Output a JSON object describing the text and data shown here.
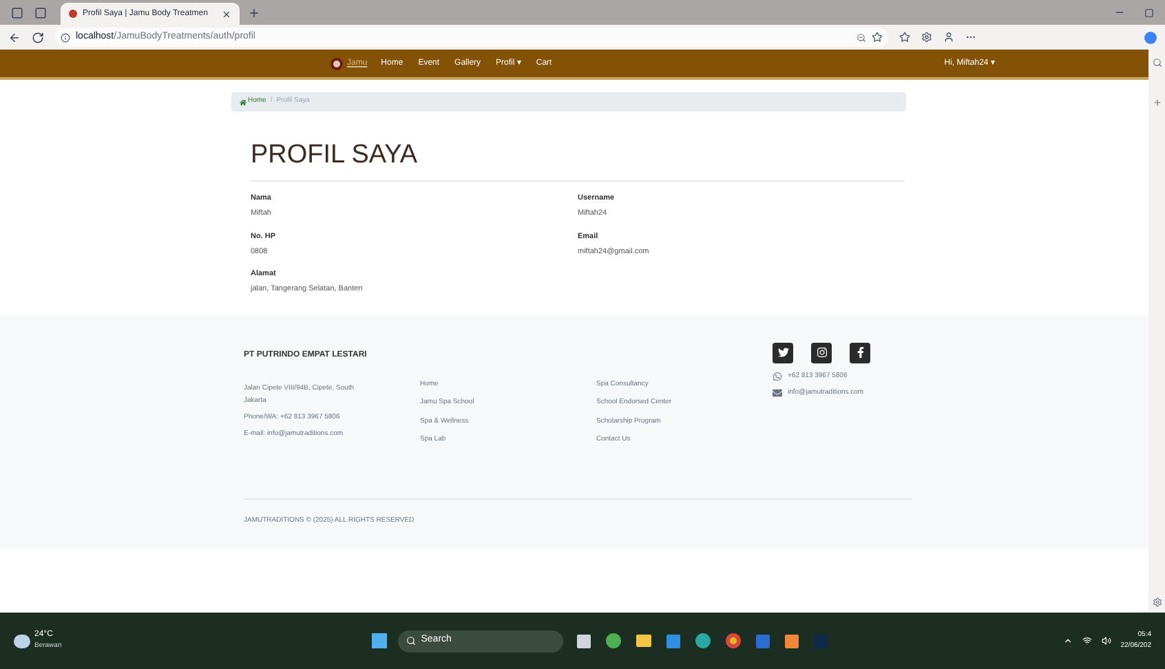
{
  "browser": {
    "tab_title": "Profil Saya | Jamu Body Treatmen",
    "url_host": "localhost",
    "url_path": "/JamuBodyTreatments/auth/profil"
  },
  "navbar": {
    "brand": "Jamu",
    "links": [
      {
        "label": "Home"
      },
      {
        "label": "Event"
      },
      {
        "label": "Gallery"
      },
      {
        "label": "Profil ▾"
      },
      {
        "label": "Cart"
      }
    ],
    "user": "Hi, Miftah24 ▾"
  },
  "breadcrumb": [
    {
      "label": "Home",
      "kind": "link"
    },
    {
      "label": "/",
      "kind": "separator"
    },
    {
      "label": "Profil Saya",
      "kind": "current"
    }
  ],
  "title": "PROFIL SAYA",
  "fields": [
    {
      "label": "Nama",
      "value": "Miftah"
    },
    {
      "label": "Username",
      "value": "Miftah24"
    },
    {
      "label": "No. HP",
      "value": "0808"
    },
    {
      "label": "Email",
      "value": "miftah24@gmail.com"
    },
    {
      "label": "Alamat",
      "value": "jalan, Tangerang Selatan, Banten"
    }
  ],
  "footer": {
    "company": "PT PUTRINDO EMPAT LESTARI",
    "address_lines": [
      "Jalan Cipete VIII/94B, Cipete, South Jakarta",
      "Phone/WA: +62 813 3967 5806",
      "E-mail: info@jamutraditions.com"
    ],
    "links_1": [
      "Home",
      "Jamu Spa School",
      "Spa & Wellness",
      "Spa Lab"
    ],
    "links_2": [
      "Spa Consultancy",
      "School Endorsed Center",
      "Scholarship Program",
      "Contact Us"
    ],
    "social": [
      {
        "kind": "twitter"
      },
      {
        "kind": "instagram"
      },
      {
        "kind": "facebook"
      }
    ],
    "contacts": [
      {
        "kind": "phone",
        "text": "+62 813 3967 5806"
      },
      {
        "kind": "email",
        "text": "info@jamutraditions.com"
      }
    ],
    "copyright": "JAMUTRADITIONS © (2025) ALL RIGHTS RESERVED"
  },
  "taskbar": {
    "temperature": "24°C",
    "weather": "Berawan",
    "search": "Search",
    "time": "05:4",
    "date": "22/06/202"
  }
}
